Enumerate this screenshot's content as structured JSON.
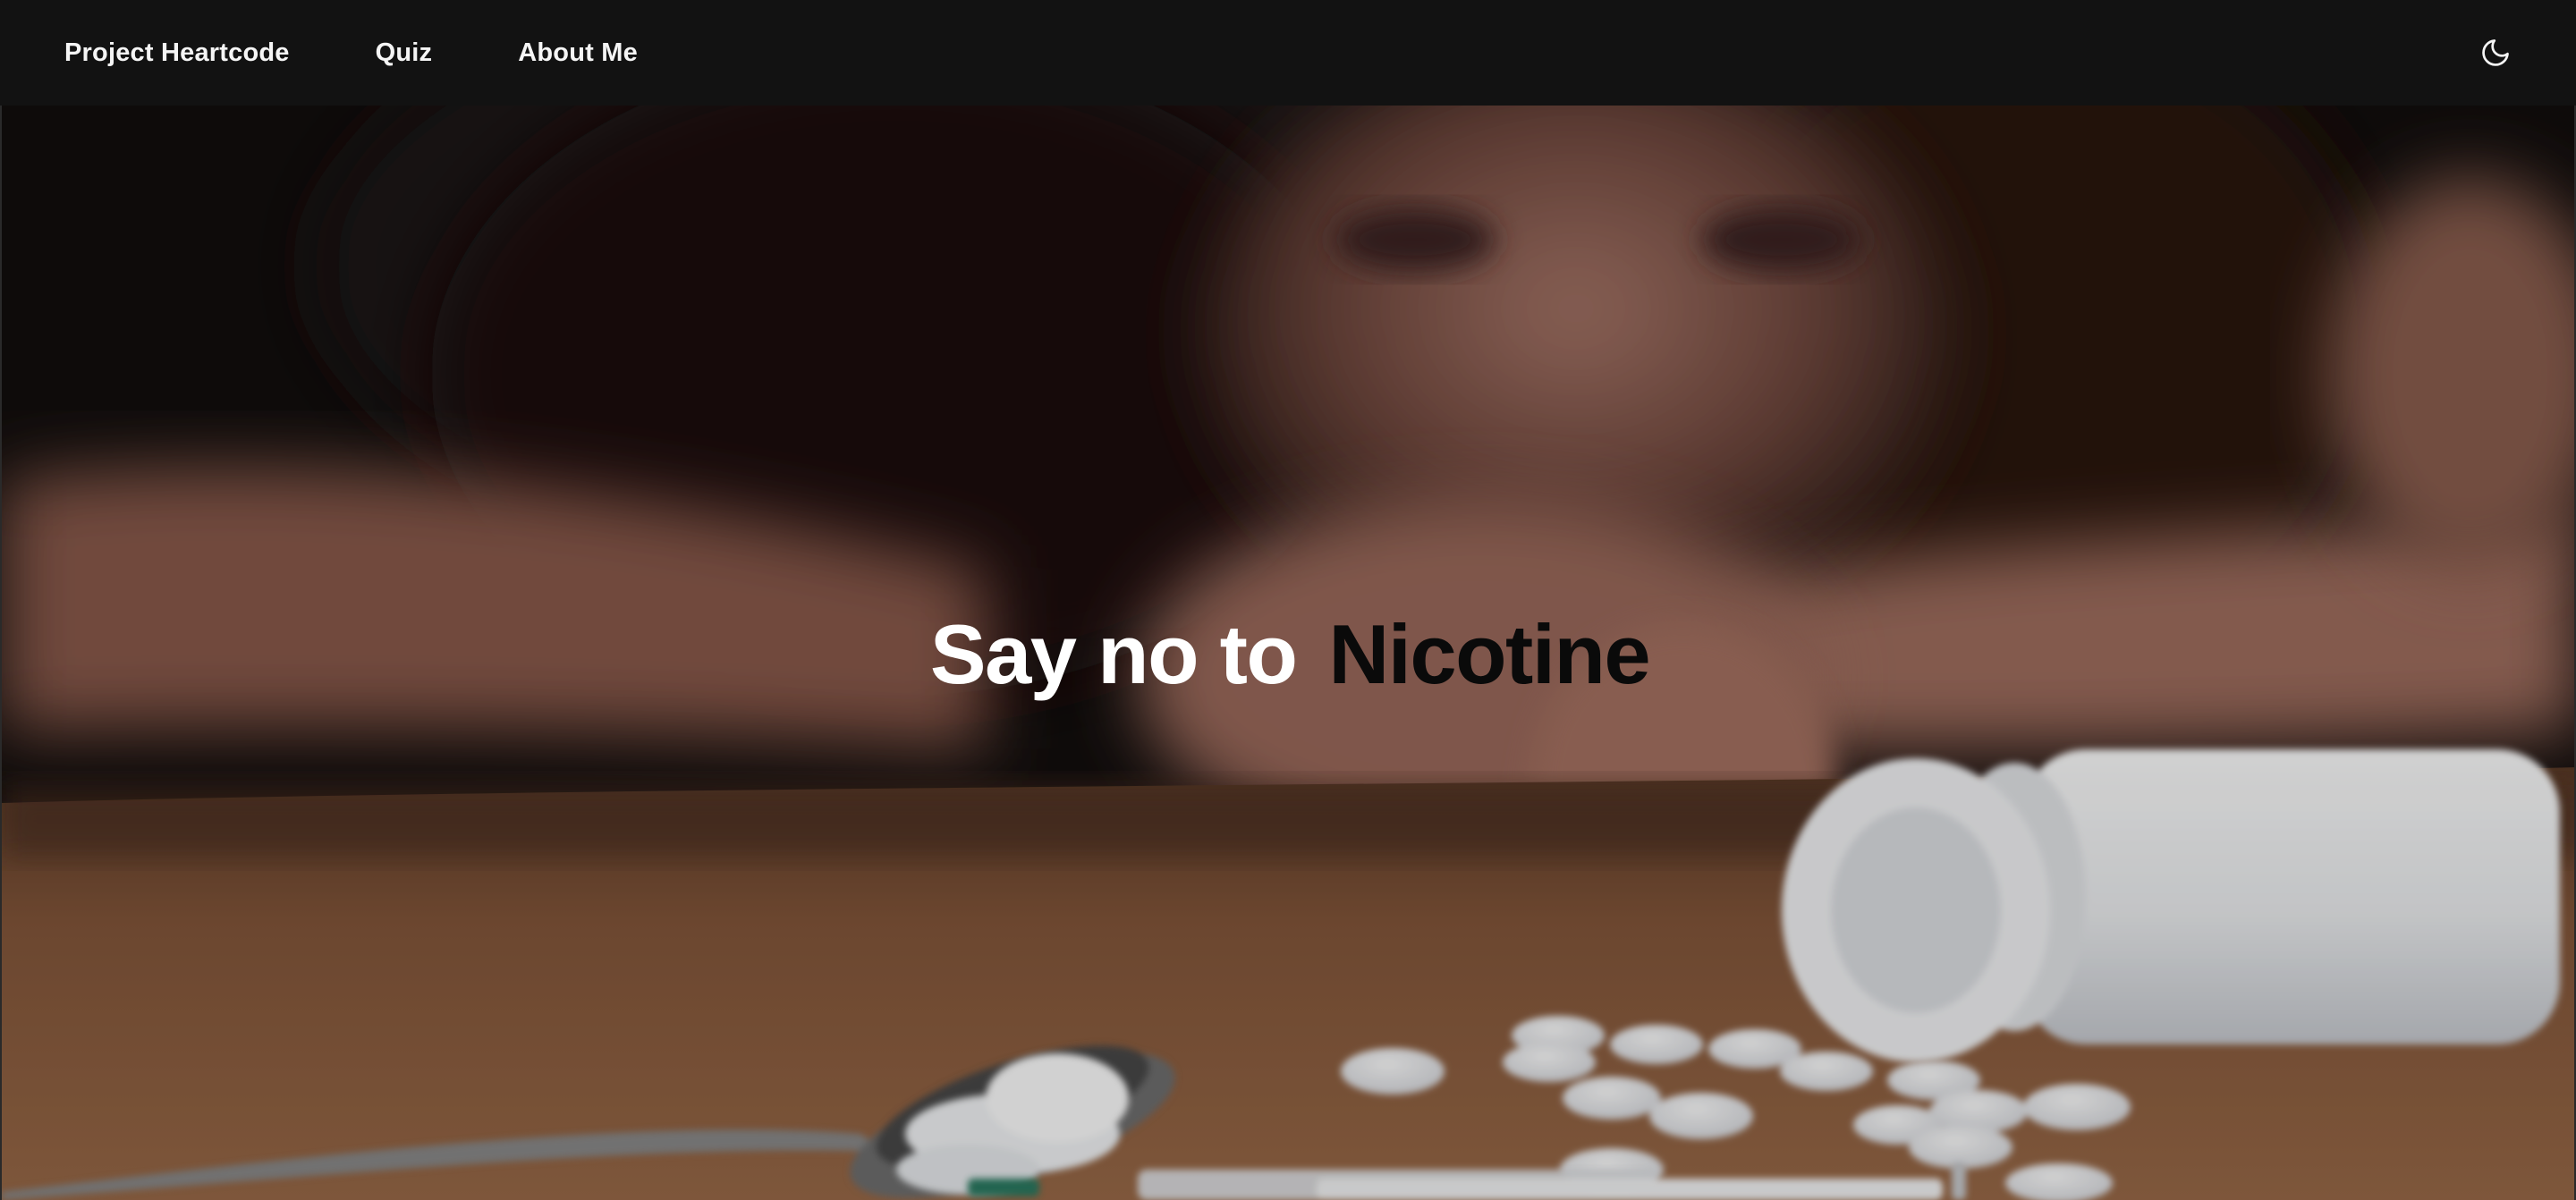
{
  "navbar": {
    "links": [
      {
        "label": "Project Heartcode"
      },
      {
        "label": "Quiz"
      },
      {
        "label": "About Me"
      }
    ],
    "theme_toggle_icon": "moon-icon"
  },
  "hero": {
    "headline_lead": "Say no to",
    "headline_accent": "Nicotine",
    "background_image": "blurred-person-with-spilled-pills-photo"
  },
  "colors": {
    "nav_background": "#121212",
    "nav_text": "#f5f5f5",
    "headline_lead": "#ffffff",
    "headline_accent": "#0a0a0a",
    "table_wood": "#8a5a3a"
  }
}
